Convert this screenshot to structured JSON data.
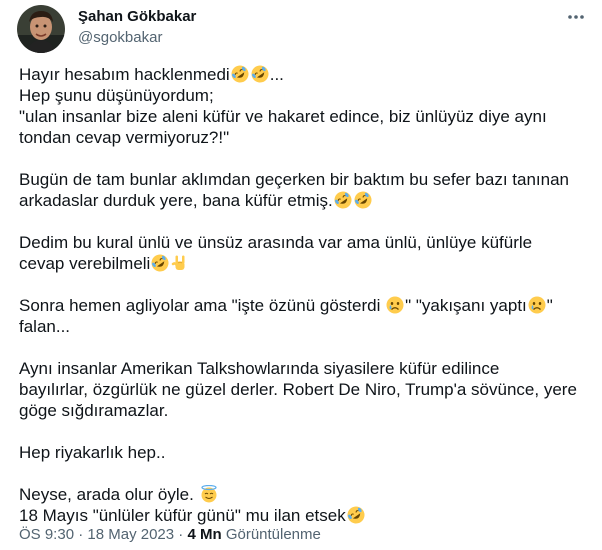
{
  "author": {
    "name": "Şahan Gökbakar",
    "handle": "@sgokbakar"
  },
  "tweet": {
    "p1": [
      "Hayır hesabım hacklenmedi",
      "...",
      "Hep şunu düşünüyordum;",
      "\"ulan  insanlar bize aleni küfür ve hakaret edince, biz ünlüyüz diye aynı",
      "tondan cevap vermiyoruz?!\""
    ],
    "p2": [
      "Bugün de tam bunlar aklımdan geçerken bir baktım bu sefer bazı tanınan",
      "arkadaslar durduk yere, bana küfür etmiş."
    ],
    "p3": [
      "Dedim bu kural ünlü ve ünsüz arasında var ama ünlü, ünlüye küfürle",
      "cevap verebilmeli"
    ],
    "p4": [
      "Sonra hemen agliyolar ama \"işte özünü gösterdi ",
      "\" \"yakışanı yaptı",
      "\"",
      "falan..."
    ],
    "p5": [
      "Aynı insanlar Amerikan Talkshowlarında siyasilere küfür edilince",
      "bayılırlar, özgürlük ne güzel derler. Robert De Niro, Trump'a sövünce, yere",
      "göge sığdıramazlar."
    ],
    "p6": [
      "Hep riyakarlık hep.."
    ],
    "p7": [
      "Neyse, arada olur öyle. ",
      "18 Mayıs \"ünlüler küfür günü\" mu ilan etsek"
    ]
  },
  "meta": {
    "time": "ÖS 9:30",
    "sep1": " · ",
    "date": "18 May 2023",
    "sep2": " · ",
    "views_count": "4 Mn",
    "views_label": "Görüntülenme"
  },
  "icons": {
    "laugh": "rolling-on-floor-laughing-emoji",
    "horns": "sign-of-horns-emoji",
    "cry": "crying-face-emoji",
    "halo": "smiling-face-with-halo-emoji",
    "more": "more-icon"
  },
  "colors": {
    "text": "#0f1419",
    "secondary": "#536471",
    "emoji_yellow": "#ffcc4d",
    "tear_blue": "#5dadec"
  }
}
